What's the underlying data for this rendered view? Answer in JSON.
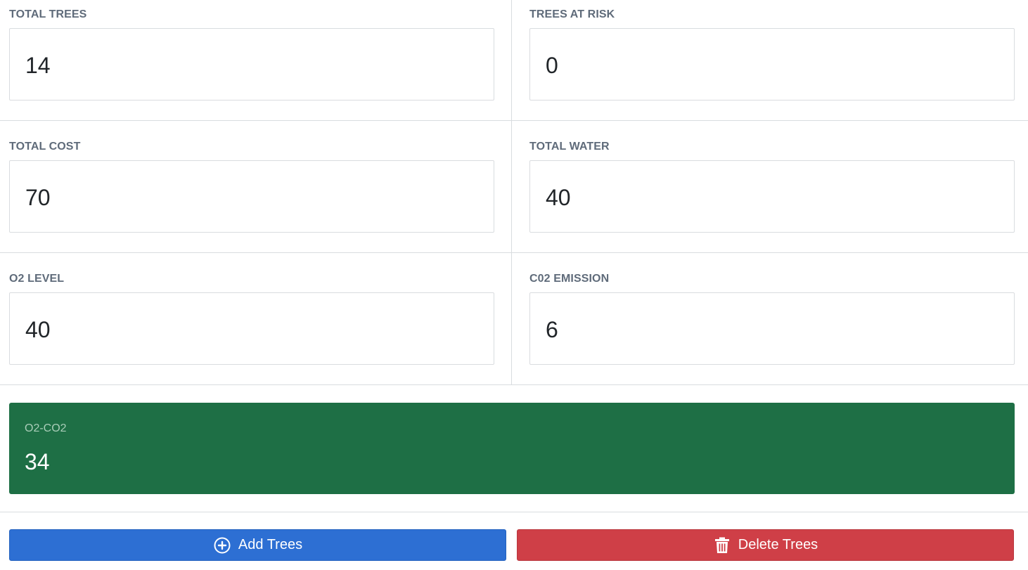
{
  "stats": {
    "total_trees": {
      "label": "TOTAL TREES",
      "value": "14"
    },
    "trees_at_risk": {
      "label": "TREES AT RISK",
      "value": "0"
    },
    "total_cost": {
      "label": "TOTAL COST",
      "value": "70"
    },
    "total_water": {
      "label": "TOTAL WATER",
      "value": "40"
    },
    "o2_level": {
      "label": "O2 LEVEL",
      "value": "40"
    },
    "co2_emission": {
      "label": "C02 EMISSION",
      "value": "6"
    }
  },
  "balance": {
    "label": "O2-CO2",
    "value": "34",
    "color": "#1e6f45"
  },
  "actions": {
    "add_label": "Add Trees",
    "add_icon": "plus-circle-icon",
    "add_color": "#2d6fd3",
    "delete_label": "Delete Trees",
    "delete_icon": "trash-icon",
    "delete_color": "#cf3f47"
  }
}
